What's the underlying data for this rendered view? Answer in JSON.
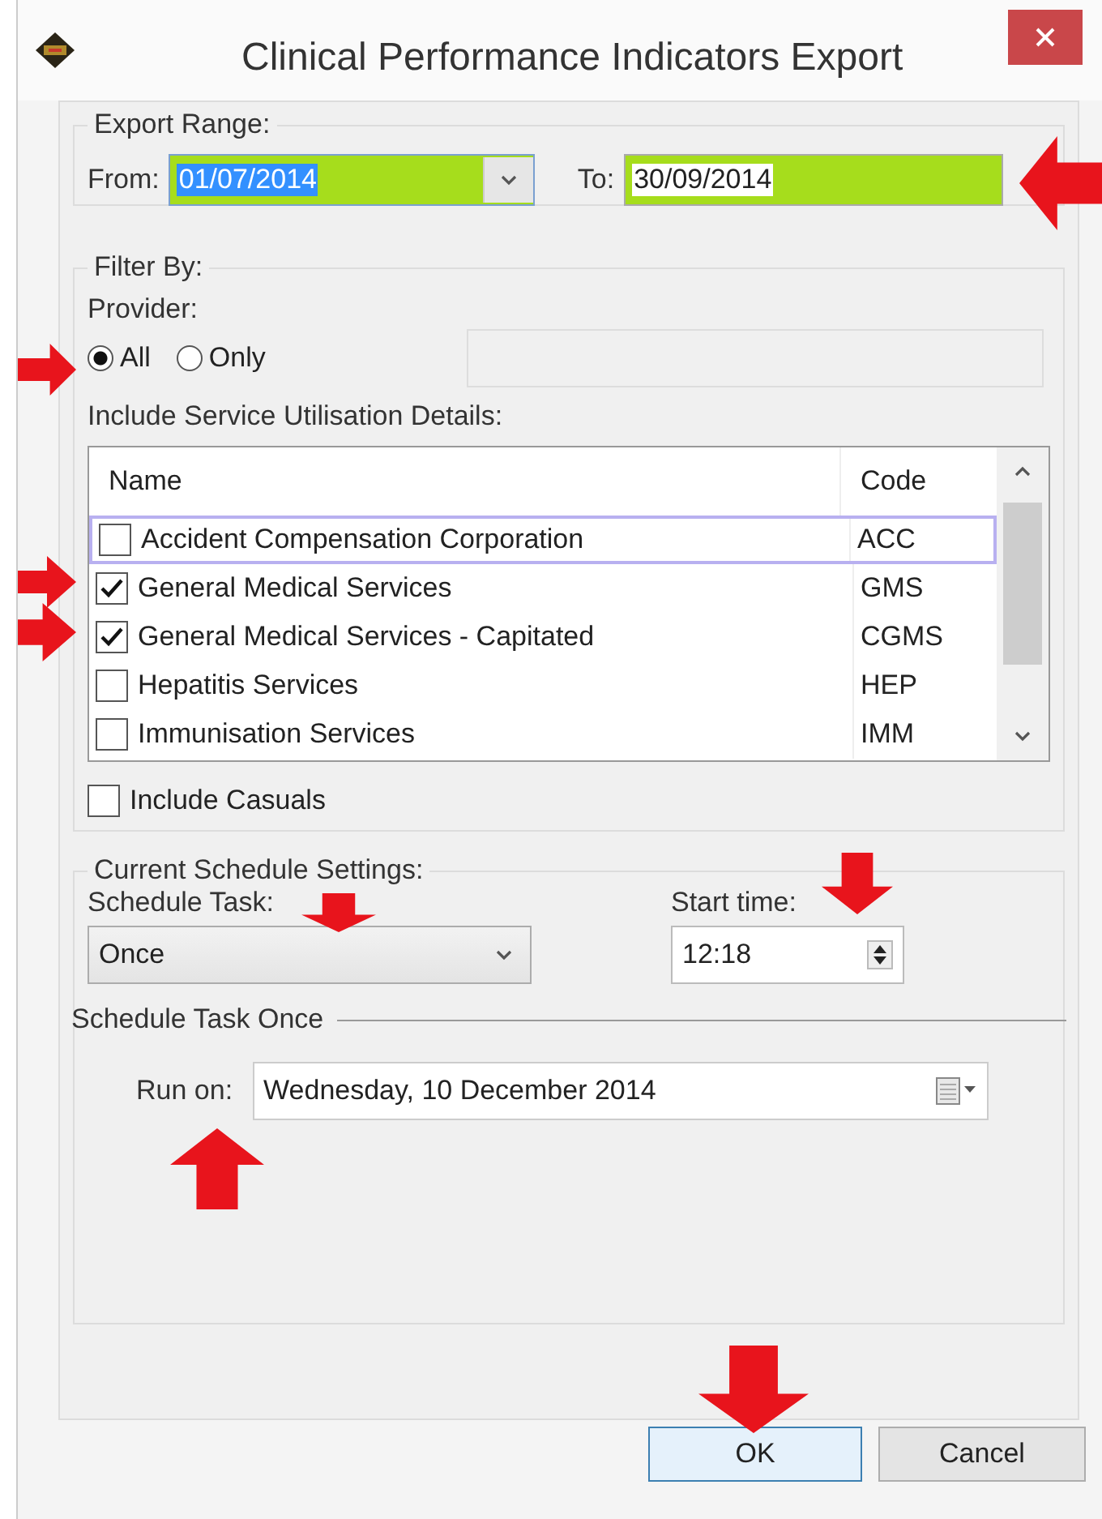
{
  "window": {
    "title": "Clinical Performance Indicators Export"
  },
  "export_range": {
    "legend": "Export Range:",
    "from": {
      "label": "From:",
      "value": "01/07/2014",
      "highlighted": true,
      "text_selected": true
    },
    "to": {
      "label": "To:",
      "value": "30/09/2014",
      "highlighted": true,
      "text_selected": false
    }
  },
  "filter_by": {
    "legend": "Filter By:",
    "provider_label": "Provider:",
    "provider_options": [
      {
        "label": "All",
        "selected": true
      },
      {
        "label": "Only",
        "selected": false
      }
    ],
    "services_label": "Include Service Utilisation Details:",
    "services": {
      "columns": [
        "Name",
        "Code"
      ],
      "rows": [
        {
          "name": "Accident Compensation Corporation",
          "code": "ACC",
          "checked": false,
          "focused": true
        },
        {
          "name": "General Medical Services",
          "code": "GMS",
          "checked": true,
          "focused": false
        },
        {
          "name": "General Medical Services - Capitated",
          "code": "CGMS",
          "checked": true,
          "focused": false
        },
        {
          "name": "Hepatitis Services",
          "code": "HEP",
          "checked": false,
          "focused": false
        },
        {
          "name": "Immunisation Services",
          "code": "IMM",
          "checked": false,
          "focused": false
        }
      ]
    },
    "include_casuals": {
      "label": "Include Casuals",
      "checked": false
    }
  },
  "schedule": {
    "legend": "Current Schedule Settings:",
    "task_label": "Schedule Task:",
    "task_value": "Once",
    "start_label": "Start time:",
    "start_value": "12:18",
    "once_heading": "Schedule Task Once",
    "run_on_label": "Run on:",
    "run_on_value": "Wednesday, 10 December 2014"
  },
  "buttons": [
    {
      "label": "OK",
      "default": true
    },
    {
      "label": "Cancel",
      "default": false
    }
  ]
}
